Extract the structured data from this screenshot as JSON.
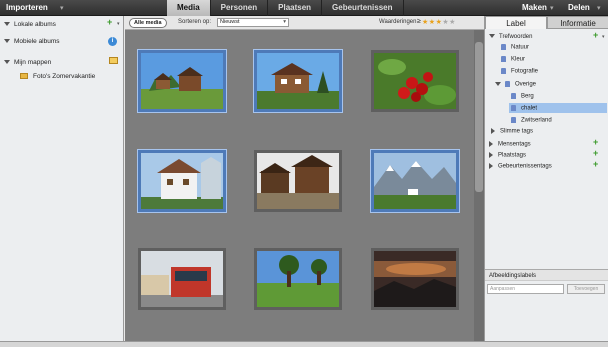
{
  "topbar": {
    "import_label": "Importeren",
    "tabs": [
      "Media",
      "Personen",
      "Plaatsen",
      "Gebeurtenissen"
    ],
    "create_label": "Maken",
    "share_label": "Delen"
  },
  "left_panel": {
    "local_albums": "Lokale albums",
    "mobile_albums": "Mobiele albums",
    "my_folders": "Mijn mappen",
    "folder_name": "Foto's Zomervakantie"
  },
  "toolbar": {
    "all_media": "Alle media",
    "sort_label": "Sorteren op:",
    "sort_value": "Nieuwst",
    "ratings_label": "Waarderingen",
    "ratings_op": "≥",
    "rating_stars": 3,
    "rating_max": 5
  },
  "right_panel": {
    "tab_label": "Label",
    "tab_info": "Informatie",
    "keywords": "Trefwoorden",
    "kw_items": [
      "Natuur",
      "Kleur",
      "Fotografie"
    ],
    "other": "Overige",
    "sub_items": [
      "Berg",
      "chalet",
      "Zwitserland"
    ],
    "smart_tags": "Slimme tags",
    "people_tags": "Mensentags",
    "place_tags": "Plaatstags",
    "event_tags": "Gebeurtenissentags",
    "image_labels": "Afbeeldingslabels",
    "input_placeholder": "Aanpassen",
    "add_button": "Toevoegen"
  },
  "colors": {
    "accent_blue": "#4e7ab8",
    "selection": "#9fc2ec",
    "star": "#e9a21c"
  }
}
